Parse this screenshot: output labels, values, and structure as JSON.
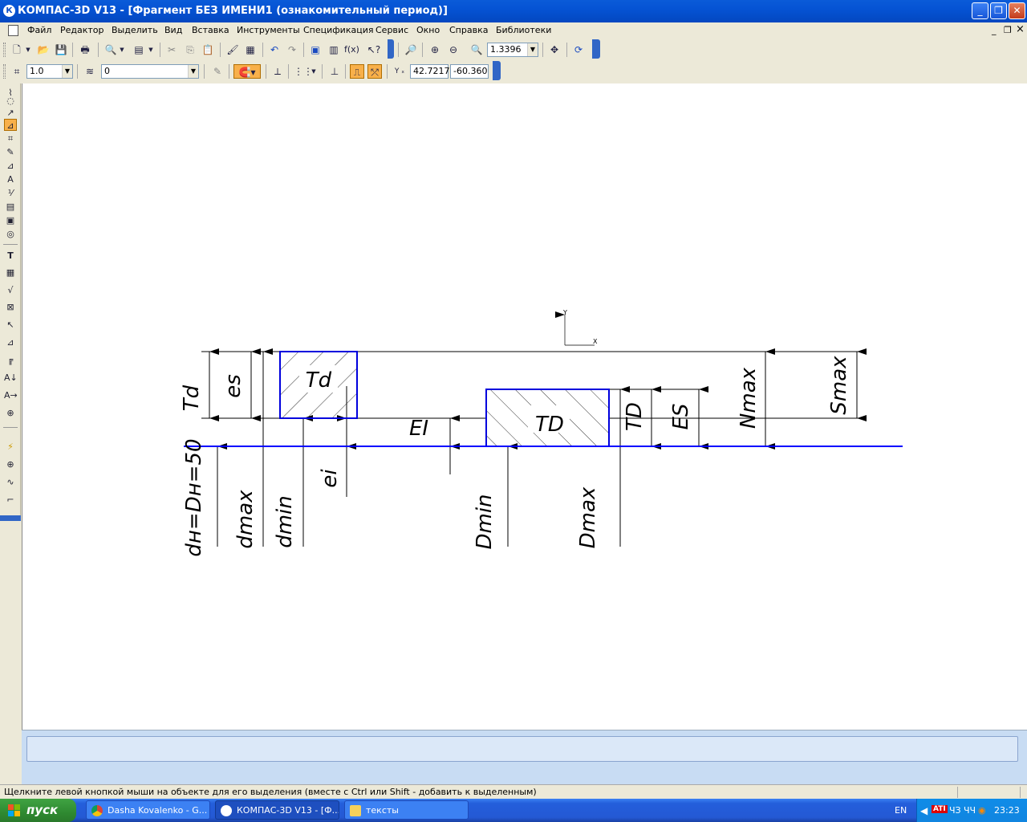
{
  "window": {
    "title": "КОМПАС-3D V13 - [Фрагмент БЕЗ ИМЕНИ1 (ознакомительный период)]",
    "logo_letter": "К",
    "min": "_",
    "max": "❐",
    "close": "✕"
  },
  "menu": {
    "items": [
      "Файл",
      "Редактор",
      "Выделить",
      "Вид",
      "Вставка",
      "Инструменты",
      "Спецификация",
      "Сервис",
      "Окно",
      "Справка",
      "Библиотеки"
    ],
    "mdi_min": "_",
    "mdi_restore": "❐",
    "mdi_close": "×"
  },
  "toolbar_standard": {
    "zoom_value": "1.3396"
  },
  "toolbar_current": {
    "step_value": "1.0",
    "layer_value": "0",
    "coord_x": "42.7217",
    "coord_y": "-60.360",
    "axis_label": "Y ₓ"
  },
  "drawing": {
    "labels": {
      "Td_outer": "Td",
      "es": "es",
      "Td_box": "Td",
      "EI": "EI",
      "TD_box": "TD",
      "TD_outer": "TD",
      "ES": "ES",
      "Nmax": "Nmax",
      "Smax": "Smax",
      "nominal": "dн=Dн=50",
      "dmax": "dmax",
      "dmin": "dmin",
      "ei": "ei",
      "Dmin": "Dmin",
      "Dmax": "Dmax",
      "axis_y": "Y",
      "axis_x": "X"
    },
    "colors": {
      "zero_line": "#0000ff",
      "box": "#0000dd",
      "lines": "#000000"
    }
  },
  "status": {
    "hint": "Щелкните левой кнопкой мыши на объекте для его выделения (вместе с Ctrl или Shift - добавить к выделенным)"
  },
  "taskbar": {
    "start": "пуск",
    "tasks": [
      {
        "label": "Dasha Kovalenko - G..."
      },
      {
        "label": "КОМПАС-3D V13 - [Ф..."
      },
      {
        "label": "тексты"
      }
    ],
    "lang": "EN",
    "tray_text1": "ЧЗ",
    "tray_text2": "ЧЧ",
    "clock": "23:23"
  }
}
